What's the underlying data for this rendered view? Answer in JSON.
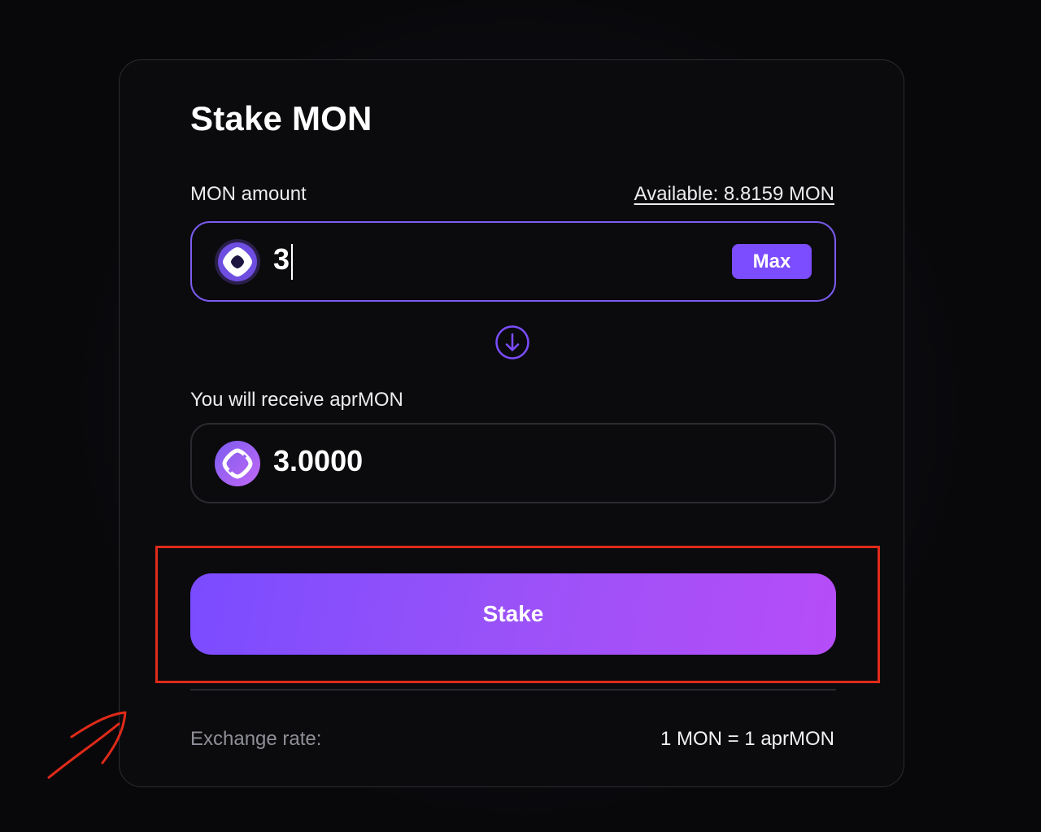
{
  "card": {
    "title": "Stake MON"
  },
  "input": {
    "label": "MON amount",
    "available": "Available: 8.8159 MON",
    "value": "3",
    "max_label": "Max",
    "token_icon": "mon-token-icon"
  },
  "output": {
    "label": "You will receive aprMON",
    "value": "3.0000",
    "token_icon": "aprmon-token-icon"
  },
  "actions": {
    "stake_label": "Stake"
  },
  "exchange": {
    "label": "Exchange rate:",
    "value": "1 MON = 1 aprMON"
  },
  "icons": {
    "swap_direction": "arrow-down-circle-icon"
  },
  "colors": {
    "accent": "#7c4dff",
    "stake_gradient_start": "#7a4cff",
    "stake_gradient_end": "#b64df9",
    "annotation": "#e02a1a"
  }
}
